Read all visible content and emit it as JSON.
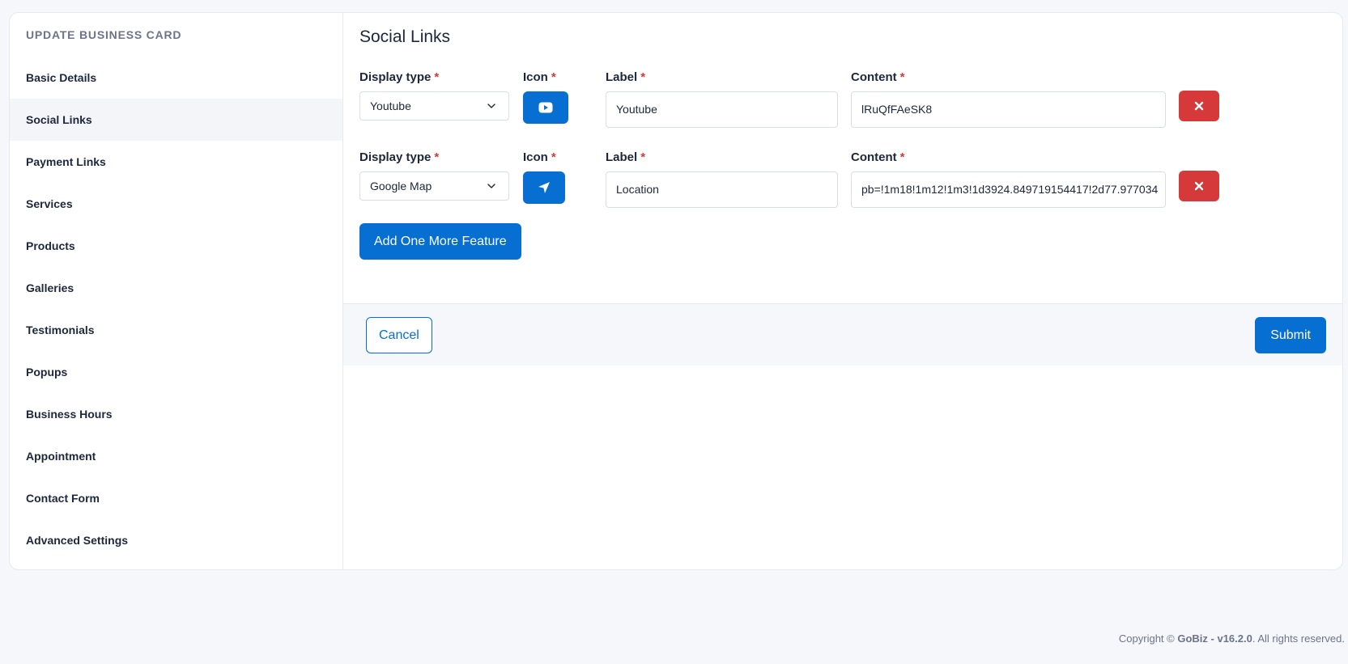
{
  "sidebar": {
    "title": "UPDATE BUSINESS CARD",
    "items": [
      {
        "label": "Basic Details"
      },
      {
        "label": "Social Links"
      },
      {
        "label": "Payment Links"
      },
      {
        "label": "Services"
      },
      {
        "label": "Products"
      },
      {
        "label": "Galleries"
      },
      {
        "label": "Testimonials"
      },
      {
        "label": "Popups"
      },
      {
        "label": "Business Hours"
      },
      {
        "label": "Appointment"
      },
      {
        "label": "Contact Form"
      },
      {
        "label": "Advanced Settings"
      }
    ],
    "active_index": 1
  },
  "main": {
    "title": "Social Links",
    "field_labels": {
      "display_type": "Display type",
      "icon": "Icon",
      "label": "Label",
      "content": "Content",
      "required_mark": "*"
    },
    "rows": [
      {
        "display_type": "Youtube",
        "icon": "youtube-icon",
        "label": "Youtube",
        "content": "lRuQfFAeSK8"
      },
      {
        "display_type": "Google Map",
        "icon": "location-arrow-icon",
        "label": "Location",
        "content": "pb=!1m18!1m12!1m3!1d3924.849719154417!2d77.977034"
      }
    ],
    "add_button": "Add One More Feature",
    "cancel_button": "Cancel",
    "submit_button": "Submit"
  },
  "footer": {
    "prefix": "Copyright ©",
    "brand": "GoBiz - v16.2.0",
    "suffix": ". All rights reserved."
  },
  "colors": {
    "primary": "#066fd1",
    "danger": "#d63939",
    "background": "#f5f7fb"
  }
}
